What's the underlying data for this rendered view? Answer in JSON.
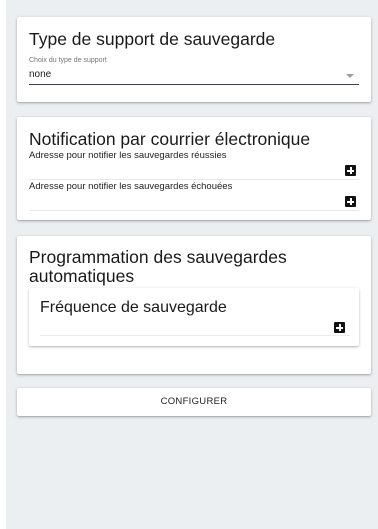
{
  "support_card": {
    "title": "Type de support de sauvegarde",
    "select": {
      "label": "Choix du type de support",
      "value": "none"
    }
  },
  "notification_card": {
    "title": "Notification par courrier électronique",
    "success_label": "Adresse pour notifier les sauvegardes réussies",
    "failure_label": "Adresse pour notifier les sauvegardes échouées"
  },
  "programming_card": {
    "title": "Programmation des sauvegardes automatiques",
    "frequency": {
      "title": "Fréquence de sauvegarde"
    }
  },
  "configure_button": {
    "label": "CONFIGURER"
  },
  "icons": {
    "add": "plus-square-icon",
    "dropdown": "caret-down-icon"
  },
  "colors": {
    "background": "#eceff1",
    "card": "#ffffff",
    "select_underline": "#3f3a6e",
    "icon": "#111111"
  }
}
